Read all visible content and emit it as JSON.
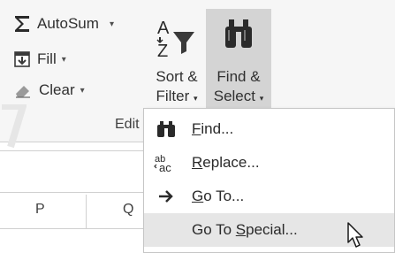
{
  "editing_group": {
    "label": "Edit",
    "autosum": {
      "label": "AutoSum",
      "caret": "▾",
      "icon": "sigma-icon"
    },
    "fill": {
      "label": "Fill",
      "caret": "▾",
      "icon": "fill-down-icon"
    },
    "clear": {
      "label": "Clear",
      "caret": "▾",
      "icon": "eraser-icon"
    },
    "sort_filter": {
      "line1": "Sort &",
      "line2": "Filter",
      "caret": "▾",
      "icon": "sort-filter-icon"
    },
    "find_select": {
      "line1": "Find &",
      "line2": "Select",
      "caret": "▾",
      "icon": "binoculars-icon"
    }
  },
  "grid": {
    "columns": [
      "P",
      "Q"
    ]
  },
  "menu": {
    "items": [
      {
        "key": "find",
        "underline": "F",
        "rest": "ind...",
        "icon": "binoculars-icon"
      },
      {
        "key": "replace",
        "underline": "R",
        "rest": "eplace...",
        "icon": "replace-icon"
      },
      {
        "key": "goto",
        "underline": "G",
        "rest": "o To...",
        "icon": "arrow-right-icon"
      },
      {
        "key": "goto_special",
        "prefix": "Go To ",
        "underline": "S",
        "rest": "pecial...",
        "icon": ""
      }
    ],
    "hovered": "goto_special"
  },
  "colors": {
    "ribbon_bg": "#f6f6f6",
    "active_button": "#d4d4d4",
    "menu_hover": "#e6e6e6"
  }
}
